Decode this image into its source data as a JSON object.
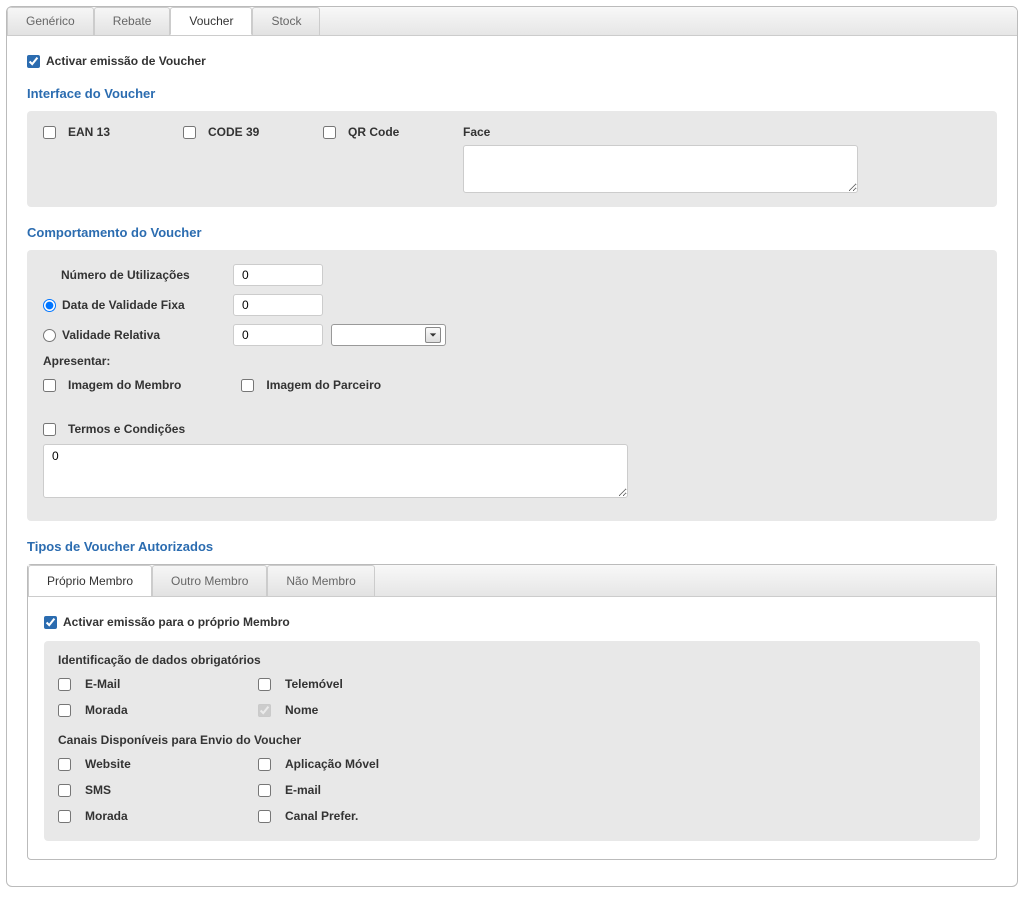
{
  "tabs": {
    "generic": "Genérico",
    "rebate": "Rebate",
    "voucher": "Voucher",
    "stock": "Stock"
  },
  "activate": "Activar emissão de Voucher",
  "interface": {
    "title": "Interface do Voucher",
    "ean13": "EAN 13",
    "code39": "CODE 39",
    "qrcode": "QR Code",
    "face": "Face"
  },
  "behavior": {
    "title": "Comportamento do Voucher",
    "num_uses": "Número de Utilizações",
    "num_uses_val": "0",
    "fixed_date": "Data de Validade Fixa",
    "fixed_date_val": "0",
    "relative": "Validade Relativa",
    "relative_val": "0",
    "show": "Apresentar:",
    "member_img": "Imagem do Membro",
    "partner_img": "Imagem do Parceiro",
    "terms": "Termos e Condições",
    "terms_val": "0"
  },
  "auth": {
    "title": "Tipos de Voucher Autorizados",
    "tabs": {
      "own": "Próprio Membro",
      "other": "Outro Membro",
      "non": "Não Membro"
    },
    "activate_own": "Activar emissão para o próprio Membro",
    "ident_title": "Identificação de dados obrigatórios",
    "email": "E-Mail",
    "phone": "Telemóvel",
    "address": "Morada",
    "name": "Nome",
    "channels_title": "Canais Disponíveis para Envio do Voucher",
    "website": "Website",
    "app": "Aplicação Móvel",
    "sms": "SMS",
    "email2": "E-mail",
    "address2": "Morada",
    "pref": "Canal Prefer."
  }
}
